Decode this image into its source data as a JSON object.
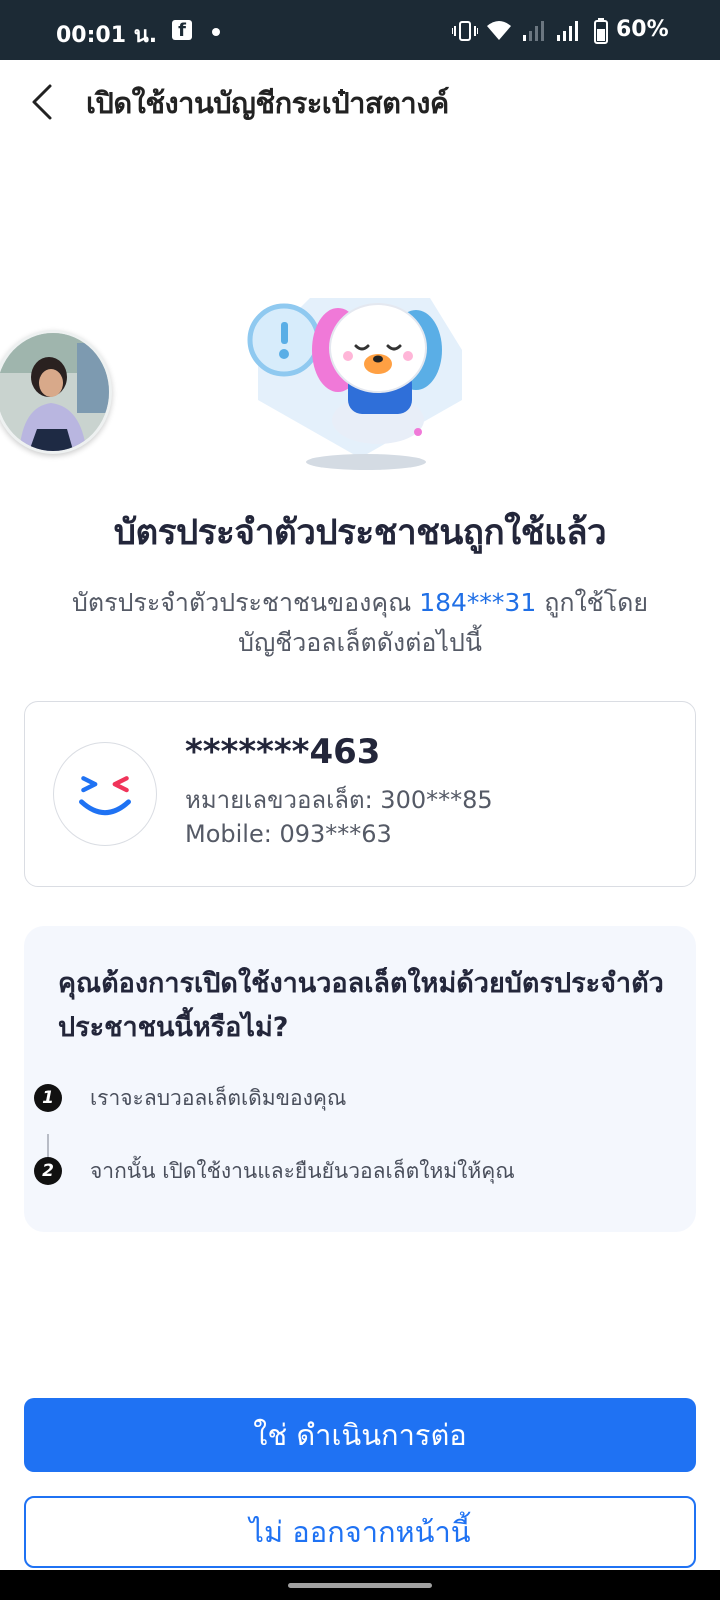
{
  "status_bar": {
    "time": "00:01 น.",
    "battery": "60%",
    "icons": [
      "facebook-icon",
      "notification-dot-icon",
      "vibrate-icon",
      "wifi-icon",
      "signal-weak-icon",
      "signal-icon",
      "battery-icon"
    ]
  },
  "header": {
    "title": "เปิดใช้งานบัญชีกระเป๋าสตางค์",
    "back_icon": "chevron-left-icon"
  },
  "main": {
    "headline": "บัตรประจำตัวประชาชนถูกใช้แล้ว",
    "description_prefix": "บัตรประจำตัวประชาชนของคุณ",
    "id_masked": "184***31",
    "description_suffix": "ถูกใช้โดย",
    "description_line2": "บัญชีวอลเล็ตดังต่อไปนี้"
  },
  "wallet": {
    "masked_name": "*******463",
    "wallet_number": "หมายเลขวอลเล็ต: 300***85",
    "mobile": "Mobile: 093***63"
  },
  "question": {
    "text": "คุณต้องการเปิดใช้งานวอลเล็ตใหม่ด้วยบัตรประจำตัวประชาชนนี้หรือไม่?",
    "steps": [
      {
        "num": "1",
        "text": "เราจะลบวอลเล็ตเดิมของคุณ"
      },
      {
        "num": "2",
        "text": "จากนั้น เปิดใช้งานและยืนยันวอลเล็ตใหม่ให้คุณ"
      }
    ]
  },
  "actions": {
    "confirm_label": "ใช่ ดำเนินการต่อ",
    "exit_label": "ไม่ ออกจากหน้านี้"
  },
  "colors": {
    "accent": "#1f72f3",
    "status_bar": "#1c2a35",
    "highlight_text": "#1f6fe6"
  }
}
